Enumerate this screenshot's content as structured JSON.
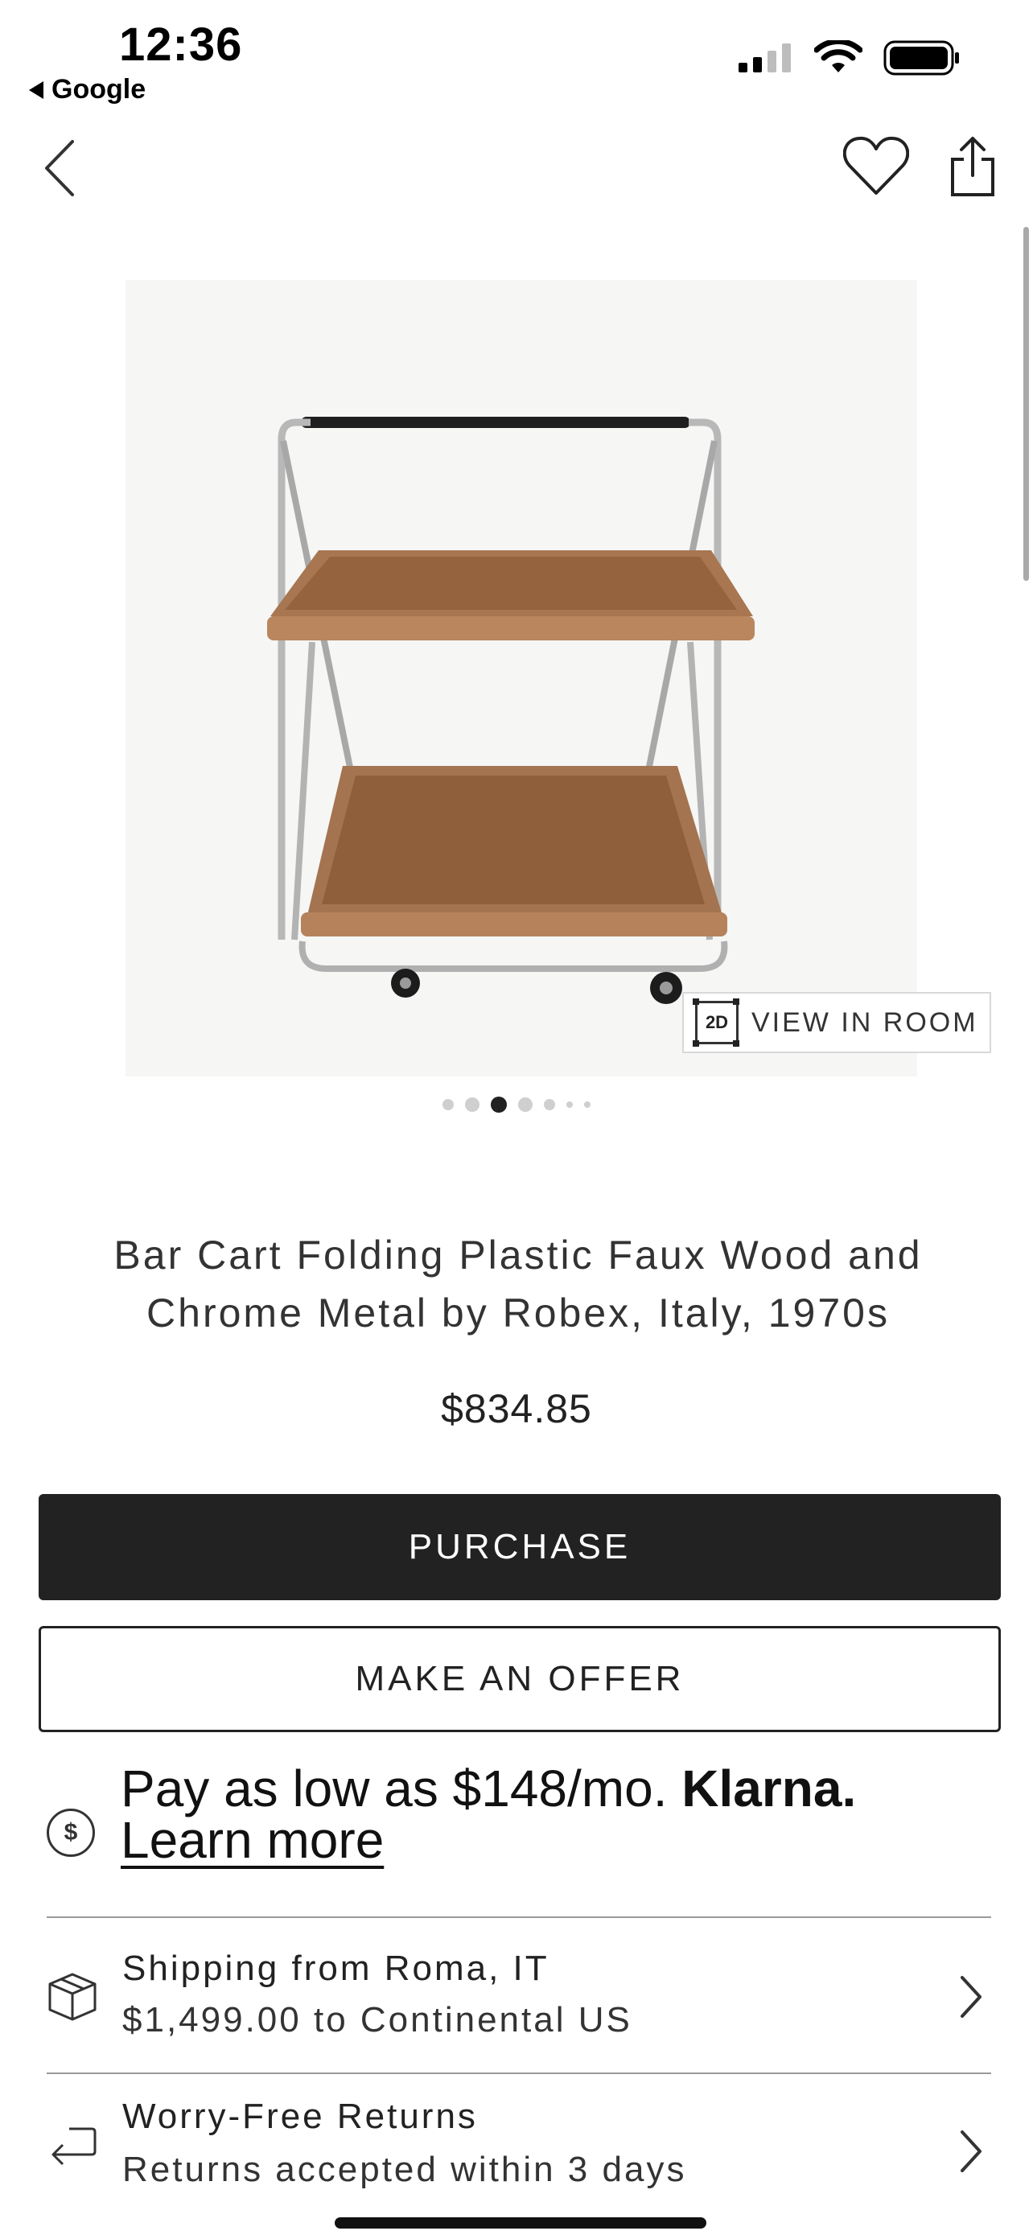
{
  "status_bar": {
    "time": "12:36",
    "back_app_label": "Google"
  },
  "nav": {
    "back_icon": "chevron-left-icon",
    "favorite_icon": "heart-icon",
    "share_icon": "share-icon"
  },
  "gallery": {
    "image_description_icon": "bar-cart-photo",
    "view_in_room_badge": "2D",
    "view_in_room_label": "VIEW IN ROOM",
    "page_count": 7,
    "active_index": 2
  },
  "product": {
    "title_line1": "Bar Cart Folding Plastic Faux Wood and",
    "title_line2": "Chrome Metal by Robex, Italy, 1970s",
    "price": "$834.85"
  },
  "actions": {
    "purchase_label": "PURCHASE",
    "offer_label": "MAKE AN OFFER"
  },
  "financing": {
    "icon": "dollar-circle-icon",
    "text": "Pay as low as $148/mo.",
    "brand": "Klarna.",
    "learn_more": "Learn more"
  },
  "shipping": {
    "icon": "box-icon",
    "title": "Shipping from Roma, IT",
    "subtitle": "$1,499.00 to Continental US"
  },
  "returns": {
    "icon": "return-arrow-icon",
    "title": "Worry-Free Returns",
    "subtitle": "Returns accepted within 3 days"
  },
  "colors": {
    "primary_button": "#222222",
    "background": "#ffffff",
    "cart_wood": "#9a6a44",
    "chrome": "#b9b9b9"
  }
}
